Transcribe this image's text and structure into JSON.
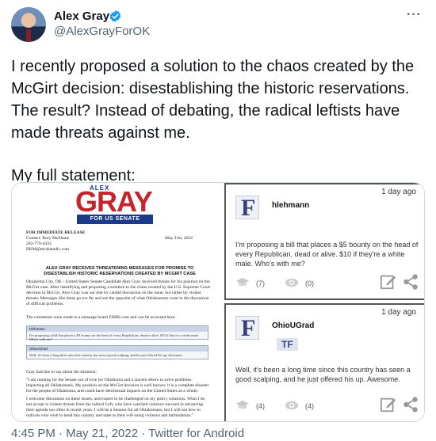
{
  "author": {
    "name": "Alex Gray",
    "handle": "@AlexGrayForOK",
    "verified_color": "#1d9bf0"
  },
  "tweet": {
    "paragraph1": "I recently proposed a solution to the chaos created by the McGirt decision: disestablishing the historic reservations. The result? Instead of debating, the radical leftists have made threats against me.",
    "paragraph2": "My full statement:"
  },
  "document": {
    "logo_top": "ALEX",
    "logo_main": "GRAY",
    "logo_bar": "FOR US SENATE",
    "release_lines": [
      "FOR IMMEDIATE RELEASE",
      "Contact: Rory McShane",
      "202-770-4433",
      "RKM@mcshanellc.com"
    ],
    "date": "May 21st, 2022",
    "headline": "ALEX GRAY RECEIVES THREATENING MESSAGES FOR PROMISE TO DISESTABLISH HISTORIC RESERVATIONS CREATED BY MCGIRT CASE",
    "para1": "Oklahoma City, OK - United States Senate Candidate Alex Gray received threats for his position on the McGirt case. After identifying and proposing a solution to the chaos created by the U.S. Supreme Court decision in McGirt, Alex Gray was not met by candid discussion on the issue, but rather by violent threats. Messages like these go too far and are the opposite of what Oklahomans want in the discussion of difficult problems.",
    "para2": "The comments were made in a message board FARK.com and can be accessed here.",
    "mini1_user": "hlehmann",
    "mini1_text": "I'm proposing a bill that places a $5 bounty on the head of every Republican, dead or alive. $10 if they're a white male. Who's with me?",
    "mini2_user": "OhioUGrad",
    "mini2_text": "Well, it's been a long time since this country has seen a good scalping, and he just offered his up. Awesome.",
    "para3": "Gray had this to say about the situation:",
    "para4": "\"I am running for the Senate out of love for Oklahoma and a sincere desire to solve problems impacting all Oklahomans. My position on the McGirt decision is well known: it is a complete disaster for the people of Oklahoma, and could have detrimental impacts on the United States as a whole.",
    "para5": "I welcome discussion on these issues, and expect to be challenged on my policy solutions. What I do not accept is violent threats from the radical Left, who have watched violence succeed in advancing their agenda too often in recent years. I will be a Senator for all Oklahomans, but I will not bow to radicals who wish to bend this country and state to their will using violence and intimidation.\""
  },
  "posts": [
    {
      "timestamp": "1 day ago",
      "avatar_letter": "F",
      "user": "hlehmann",
      "message": "I'm proposing a bill that places a $5 bounty on the head of every Republican, dead or alive. $10 if they're a white male.  Who's with me?",
      "count_a": "(7)",
      "count_b": "(0)"
    },
    {
      "timestamp": "1 day ago",
      "avatar_letter": "F",
      "user": "OhioUGrad",
      "badge": "TF",
      "message": "Well, it's been a long time since this country has seen a good scalping, and he just offered his up. Awesome.",
      "count_a": "(4)",
      "count_b": "(4)"
    }
  ],
  "meta": {
    "line": "4:45 PM · May 21, 2022 · Twitter for Android"
  },
  "icons": [
    "verified-badge-icon",
    "more-icon",
    "graduation-cap-icon",
    "eye-icon",
    "edit-icon",
    "share-icon"
  ]
}
